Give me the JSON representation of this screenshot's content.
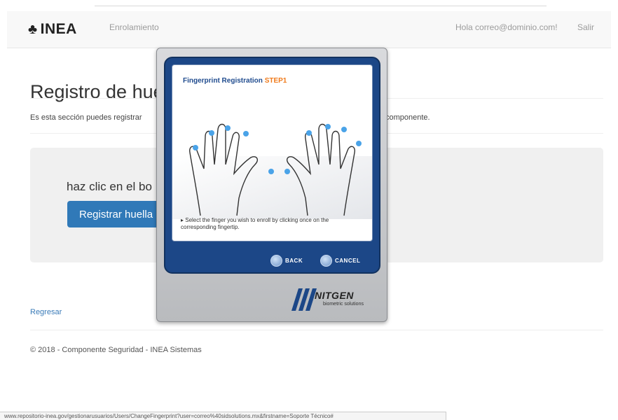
{
  "navbar": {
    "brand": "INEA",
    "brand_icon": "lotus-logo-icon",
    "enrolamiento": "Enrolamiento",
    "greeting": "Hola correo@dominio.com!",
    "logout": "Salir"
  },
  "main": {
    "title": "Registro de hue",
    "description": "Es esta sección puedes registrar",
    "description_end": "componente.",
    "well_text": "haz clic en el bo",
    "register_button": "Registrar huella",
    "back_link": "Regresar"
  },
  "footer": {
    "text": "© 2018 - Componente Seguridad - INEA Sistemas"
  },
  "statusbar": {
    "url": "www.repositorio-inea.gov/gestionarusuarios/Users/ChangeFingerprint?user=correo%40sidsolutions.mx&firstname=Soporte Técnico#"
  },
  "dialog": {
    "title": "Fingerprint Registration",
    "step": "STEP1",
    "instruction": "▸ Select the finger you wish to enroll by clicking once on the corresponding fingertip.",
    "back_label": "BACK",
    "cancel_label": "CANCEL",
    "brand": "NITGEN",
    "brand_sub": "biometric solutions",
    "fingertip_color": "#4aa3e8",
    "frame_color": "#1c4787"
  }
}
